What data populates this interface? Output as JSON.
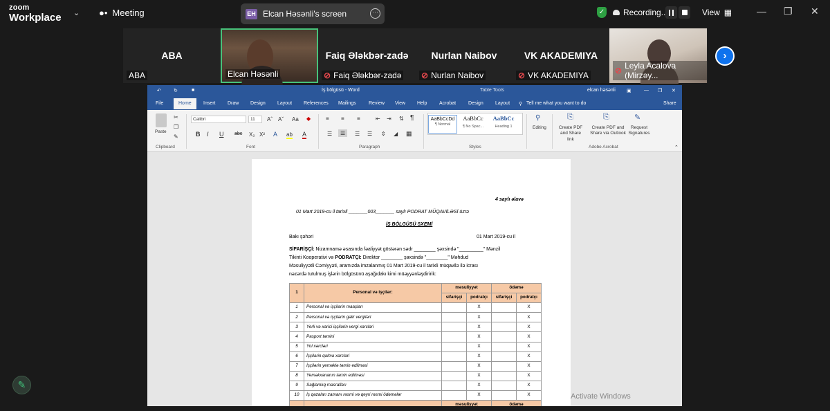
{
  "zoom": {
    "brand_line1": "zoom",
    "brand_line2": "Workplace",
    "meeting_label": "Meeting",
    "share_initials": "EH",
    "share_title": "Elcan Həsənli's screen",
    "recording_label": "Recording...",
    "view_label": "View"
  },
  "participants": [
    {
      "big": "ABA",
      "small": "ABA",
      "muted": false
    },
    {
      "big": "",
      "small": "Elcan Həsənli",
      "muted": false,
      "video": true
    },
    {
      "big": "Faiq Ələkbər-zadə",
      "small": "Faiq Ələkbər-zadə",
      "muted": true
    },
    {
      "big": "Nurlan Naibov",
      "small": "Nurlan Naibov",
      "muted": true
    },
    {
      "big": "VK AKADEMIYA",
      "small": "VK AKADEMIYA",
      "muted": true
    },
    {
      "big": "",
      "small": "Leyla Acalova (Mirzəy...",
      "muted": true,
      "video": true
    }
  ],
  "word": {
    "doc_title": "İş bölgüsü - Word",
    "table_tools": "Table Tools",
    "user": "elcan həsənli",
    "tabs": [
      "File",
      "Home",
      "Insert",
      "Draw",
      "Design",
      "Layout",
      "References",
      "Mailings",
      "Review",
      "View",
      "Help",
      "Acrobat",
      "Design",
      "Layout"
    ],
    "tell_me": "Tell me what you want to do",
    "share": "Share",
    "font_name": "Calibri",
    "font_size": "11",
    "paste": "Paste",
    "styles": [
      "AaBbCcDd",
      "AaBbCc",
      "AaBbCc"
    ],
    "style_names": [
      "¶ Normal",
      "¶ No Spac...",
      "Heading 1"
    ],
    "editing": "Editing",
    "acrobat_btns": [
      "Create PDF and Share link",
      "Create PDF and Share via Outlook",
      "Request Signatures"
    ],
    "groups": [
      "Clipboard",
      "Font",
      "Paragraph",
      "Styles",
      "Adobe Acrobat"
    ]
  },
  "doc": {
    "appendix": "4 saylı əlavə",
    "line1": "01  Mart 2019-cu il tarixli _______003_______ saylı PODRAT MÜQAVİLƏSİ üzrə",
    "heading": "İŞ BÖLGÜSÜ SXEMİ",
    "city": "Bakı şəhəri",
    "date": "01 Mart 2019-cu il",
    "p1a": "SİFARİŞÇİ:",
    "p1b": " Nizamnamə əsasında fəaliyyət göstərən sədr ________ şəxsində \"_________\" Mənzil",
    "p2a": "Tikinti Kooperativi və ",
    "p2b": "PODRATÇI:",
    "p2c": " Direktor ________  şəxsində \"________\" Məhdud",
    "p3": "Məsuliyyətli Cəmiyyəti, aramızda imzalanmış 01 Mart 2019-cu il tarixli müqavilə ilə icrası",
    "p4": "nəzərdə tutulmuş işlərin bölgüsünü aşağıdakı kimi müəyyənləşdiririk:",
    "table_head": {
      "num": "1",
      "work": "Personal və işçilər:",
      "responsibility": "məsuliyyət",
      "payment": "ödəmə",
      "sub1": "sifarişçi",
      "sub2": "podratçı",
      "sub3": "sifarişçi",
      "sub4": "podratçı"
    },
    "rows": [
      {
        "n": "1",
        "label": "Personal və işçilərin maaşları",
        "c1": "",
        "c2": "X",
        "c3": "",
        "c4": "X"
      },
      {
        "n": "2",
        "label": "Personal və işçilərin gəlir vergiləri",
        "c1": "",
        "c2": "X",
        "c3": "",
        "c4": "X"
      },
      {
        "n": "3",
        "label": "Yerli və xarici işçilərin vergi xərcləri",
        "c1": "",
        "c2": "X",
        "c3": "",
        "c4": "X"
      },
      {
        "n": "4",
        "label": "Pasport təmini",
        "c1": "",
        "c2": "X",
        "c3": "",
        "c4": "X"
      },
      {
        "n": "5",
        "label": "Yol xərcləri",
        "c1": "",
        "c2": "X",
        "c3": "",
        "c4": "X"
      },
      {
        "n": "6",
        "label": "İşçilərin qəlmə xərcləri",
        "c1": "",
        "c2": "X",
        "c3": "",
        "c4": "X"
      },
      {
        "n": "7",
        "label": "İşçilərin yeməklə təmin edilməsi",
        "c1": "",
        "c2": "X",
        "c3": "",
        "c4": "X"
      },
      {
        "n": "8",
        "label": "Yeməkxananın təmin edilməsi",
        "c1": "",
        "c2": "X",
        "c3": "",
        "c4": "X"
      },
      {
        "n": "9",
        "label": "Sağlamlıq məsrafları",
        "c1": "",
        "c2": "X",
        "c3": "",
        "c4": "X"
      },
      {
        "n": "10",
        "label": "İş qəzaları zamanı rəsmi və qeyri rəsmi ödəmələr",
        "c1": "",
        "c2": "X",
        "c3": "",
        "c4": "X"
      }
    ],
    "footer_resp": "məsuliyyət",
    "footer_pay": "ödəmə"
  },
  "activate_windows": "Activate Windows",
  "colors": {
    "zoom_bg": "#1a1a1a",
    "word_blue": "#2b579a",
    "table_head": "#f6c9a6",
    "active_speaker": "#47c27a",
    "zoom_accent": "#0e72ed"
  }
}
